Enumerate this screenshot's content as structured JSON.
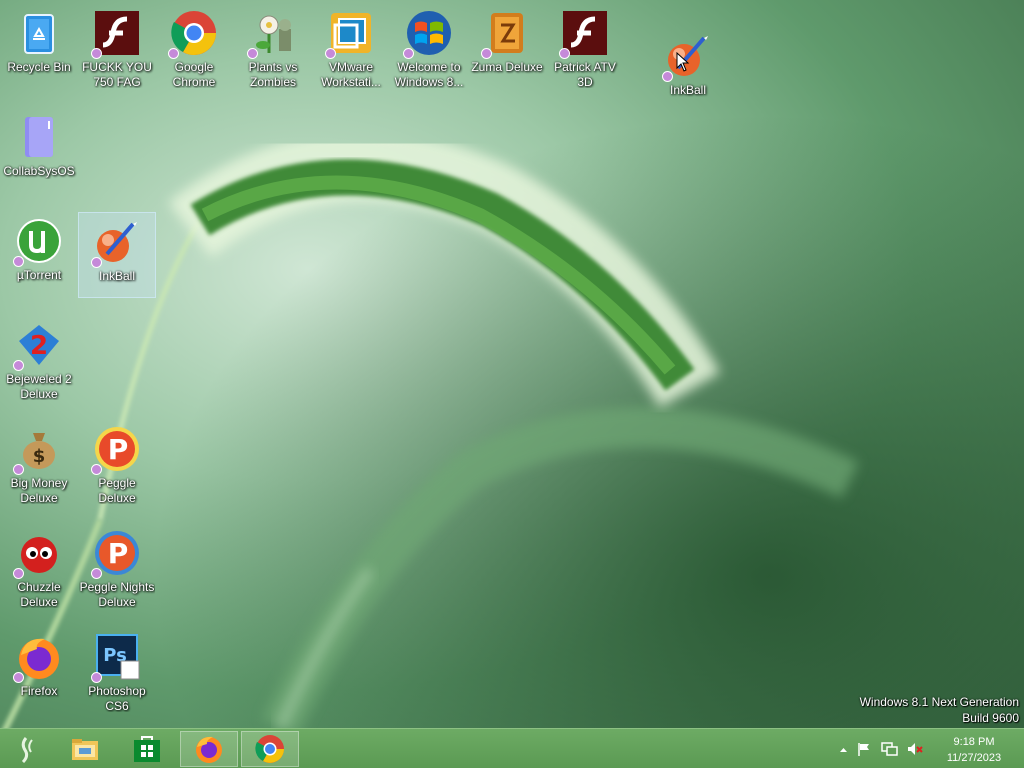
{
  "desktop": {
    "icons": [
      {
        "label": "Recycle Bin",
        "icon": "recycle-bin-icon"
      },
      {
        "label": "FUCKK YOU 750 FAG",
        "icon": "flash-icon"
      },
      {
        "label": "Google Chrome",
        "icon": "chrome-icon"
      },
      {
        "label": "Plants vs Zombies",
        "icon": "plants-vs-zombies-icon"
      },
      {
        "label": "VMware Workstati...",
        "icon": "vmware-icon"
      },
      {
        "label": "Welcome to Windows 8...",
        "icon": "windows-logo-icon"
      },
      {
        "label": "Zuma Deluxe",
        "icon": "zuma-icon"
      },
      {
        "label": "Patrick ATV 3D",
        "icon": "flash-icon"
      },
      {
        "label": "InkBall",
        "icon": "inkball-icon"
      },
      {
        "label": "CollabSysOS",
        "icon": "folder-icon"
      },
      {
        "label": "µTorrent",
        "icon": "utorrent-icon"
      },
      {
        "label": "InkBall",
        "icon": "inkball-icon"
      },
      {
        "label": "Bejeweled 2 Deluxe",
        "icon": "bejeweled-icon"
      },
      {
        "label": "Big Money Deluxe",
        "icon": "money-bag-icon"
      },
      {
        "label": "Peggle Deluxe",
        "icon": "peggle-icon"
      },
      {
        "label": "Chuzzle Deluxe",
        "icon": "chuzzle-icon"
      },
      {
        "label": "Peggle Nights Deluxe",
        "icon": "peggle-nights-icon"
      },
      {
        "label": "Firefox",
        "icon": "firefox-icon"
      },
      {
        "label": "Photoshop CS6",
        "icon": "photoshop-icon"
      }
    ]
  },
  "watermark": {
    "line1": "Windows 8.1 Next Generation",
    "line2": "Build 9600"
  },
  "taskbar": {
    "apps": [
      {
        "icon": "start-icon"
      },
      {
        "icon": "file-explorer-icon"
      },
      {
        "icon": "store-icon"
      },
      {
        "icon": "firefox-icon"
      },
      {
        "icon": "chrome-icon"
      }
    ],
    "tray": {
      "icons": [
        "show-hidden-icons-icon",
        "action-center-flag-icon",
        "network-icon",
        "volume-muted-icon"
      ]
    },
    "clock": {
      "time": "9:18 PM",
      "date": "11/27/2023"
    }
  },
  "colors": {
    "taskbar": "#5f9e57",
    "shortcut_badge": "#c58ad9"
  }
}
